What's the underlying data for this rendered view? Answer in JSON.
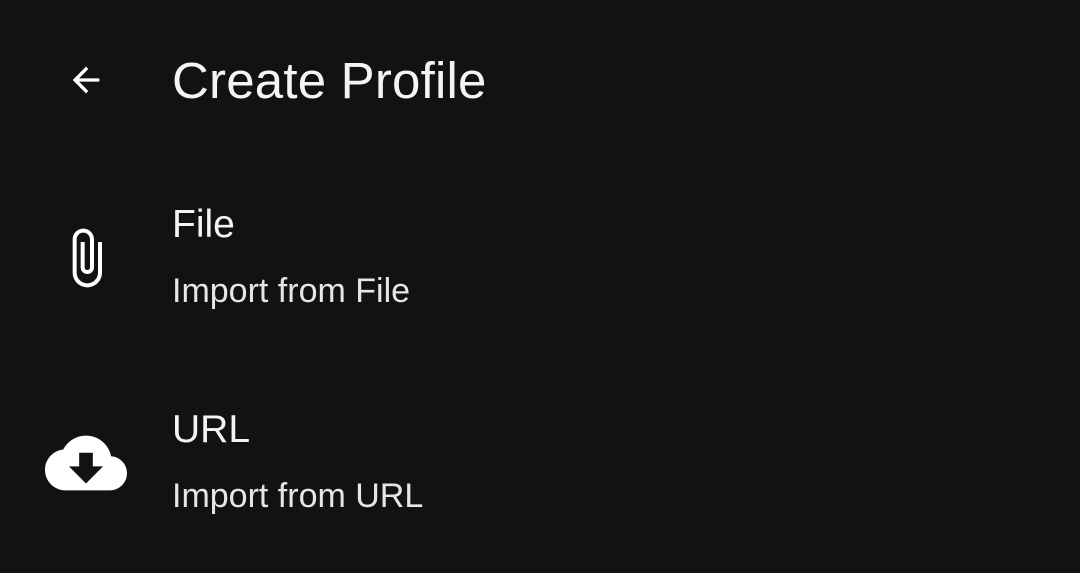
{
  "toolbar": {
    "back_icon": "arrow-back-icon",
    "title": "Create Profile"
  },
  "options": [
    {
      "icon": "paperclip-icon",
      "title": "File",
      "subtitle": "Import from File"
    },
    {
      "icon": "cloud-download-icon",
      "title": "URL",
      "subtitle": "Import from URL"
    }
  ],
  "colors": {
    "background": "#121212",
    "text_primary": "#f4f4f4",
    "text_secondary": "#e6e6e6",
    "icon": "#ffffff"
  }
}
